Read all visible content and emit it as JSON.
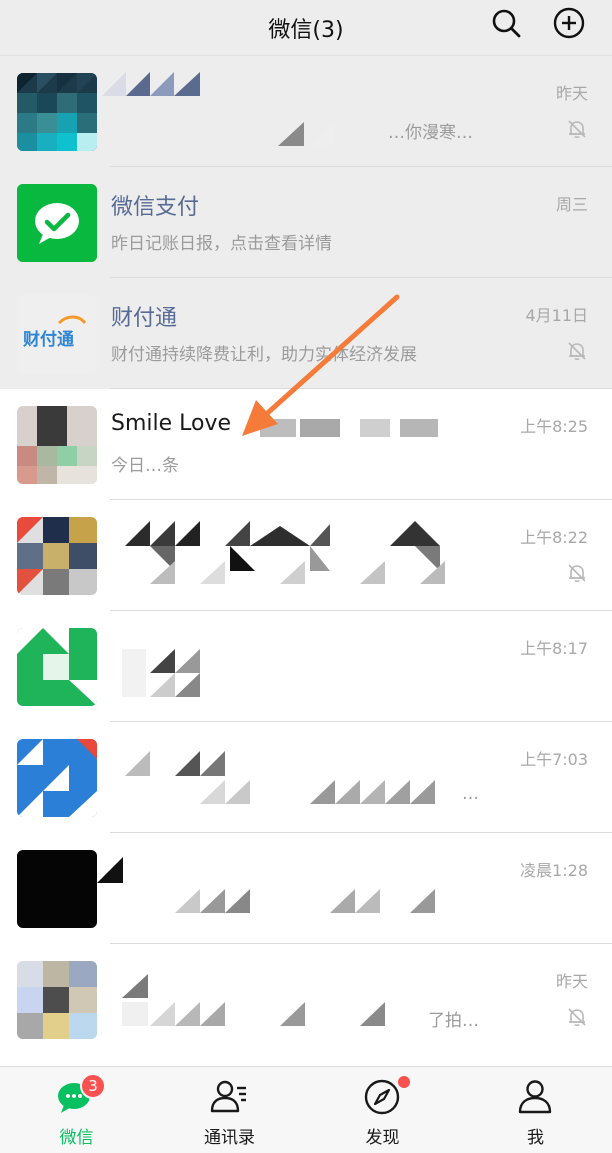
{
  "header": {
    "title": "微信(3)",
    "search_icon": "search-icon",
    "add_icon": "plus-circle-icon"
  },
  "chats": [
    {
      "name": "",
      "preview": "…你漫寒…",
      "time": "昨天",
      "muted": true,
      "pinned": true
    },
    {
      "name": "微信支付",
      "preview": "昨日记账日报，点击查看详情",
      "time": "周三",
      "muted": false,
      "pinned": true
    },
    {
      "name": "财付通",
      "preview": "财付通持续降费让利，助力实体经济发展",
      "time": "4月11日",
      "muted": true,
      "pinned": true,
      "avatar_text": "财付通"
    },
    {
      "name": "Smile Love",
      "preview": "今日…条",
      "time": "上午8:25",
      "muted": false,
      "pinned": false
    },
    {
      "name": "",
      "preview": "",
      "time": "上午8:22",
      "muted": true,
      "pinned": false
    },
    {
      "name": "",
      "preview": "",
      "time": "上午8:17",
      "muted": false,
      "pinned": false
    },
    {
      "name": "",
      "preview": "…",
      "time": "上午7:03",
      "muted": false,
      "pinned": false
    },
    {
      "name": "",
      "preview": "",
      "time": "凌晨1:28",
      "muted": false,
      "pinned": false
    },
    {
      "name": "",
      "preview": "了拍…",
      "time": "昨天",
      "muted": true,
      "pinned": false
    }
  ],
  "tabs": [
    {
      "label": "微信",
      "icon": "chat-bubble-icon",
      "active": true,
      "badge": "3"
    },
    {
      "label": "通讯录",
      "icon": "contacts-icon",
      "active": false
    },
    {
      "label": "发现",
      "icon": "compass-icon",
      "active": false,
      "dot": true
    },
    {
      "label": "我",
      "icon": "person-icon",
      "active": false
    }
  ],
  "colors": {
    "accent": "#07c160",
    "badge": "#fa5151",
    "official_name": "#576b95",
    "annotation_arrow": "#f47b3a"
  }
}
